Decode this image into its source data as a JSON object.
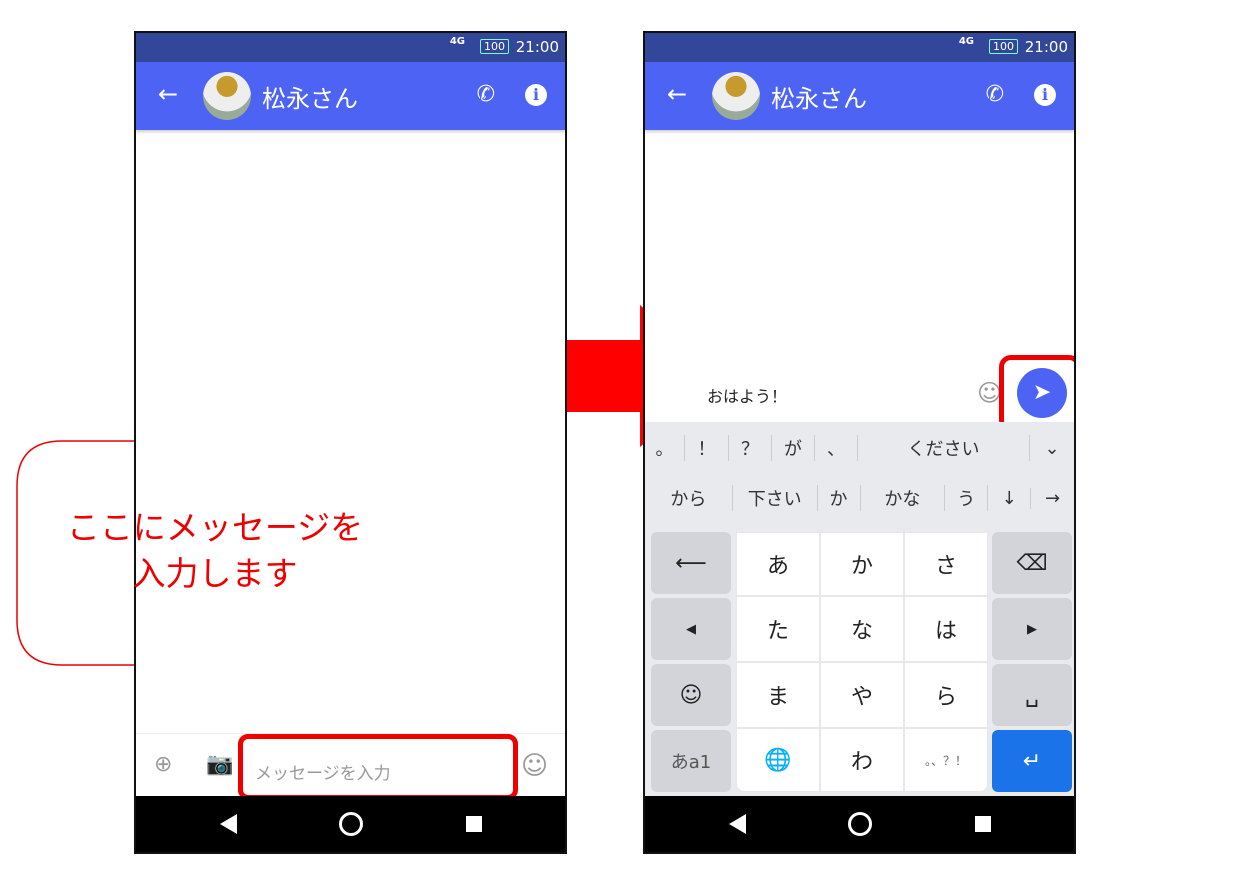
{
  "status": {
    "network": "4G",
    "battery": "100",
    "time": "21:00"
  },
  "header": {
    "contact_name": "松永さん",
    "back_icon": "←",
    "call_icon": "✆",
    "info_icon": "i"
  },
  "left": {
    "input_placeholder": "メッセージを入力",
    "callout_text_1": "ここにメッセージを",
    "callout_text_2": "入力します"
  },
  "right": {
    "input_value": "おはよう！",
    "suggestions_row1": [
      "。",
      "！",
      "？",
      "が",
      "、",
      "ください",
      "⌄"
    ],
    "suggestions_row2": [
      "から",
      "下さい",
      "か",
      "かな",
      "う",
      "↓",
      "→"
    ],
    "keys": {
      "undo": "⟵",
      "a": "あ",
      "ka": "か",
      "sa": "さ",
      "backspace": "⌫",
      "left": "◀",
      "ta": "た",
      "na": "な",
      "ha": "は",
      "right": "▶",
      "emoji": "☺",
      "ma": "ま",
      "ya": "や",
      "ra": "ら",
      "space": "␣",
      "mode": "あa1",
      "globe": "🌐",
      "wa": "わ",
      "punct": "。、？！",
      "enter": "↵"
    }
  },
  "colors": {
    "header": "#4d63f4",
    "status": "#33479a",
    "highlight": "#ee0000",
    "enter": "#1a73e8"
  }
}
